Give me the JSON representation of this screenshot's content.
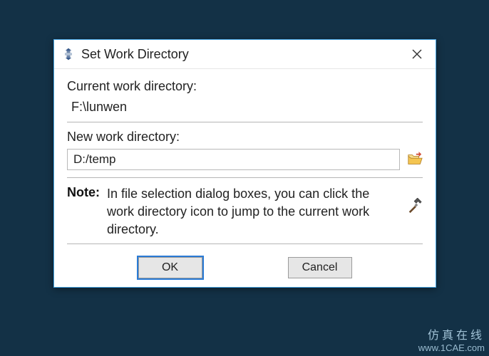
{
  "dialog": {
    "title": "Set Work Directory",
    "current_label": "Current work directory:",
    "current_value": "F:\\lunwen",
    "new_label": "New work directory:",
    "new_value": "D:/temp",
    "note_label": "Note:",
    "note_text": "In file selection dialog boxes, you can click the work directory icon to jump to the current work directory.",
    "ok_label": "OK",
    "cancel_label": "Cancel"
  },
  "watermark": {
    "line1": "仿真在线",
    "line2": "www.1CAE.com"
  },
  "bg_watermark": "CAE.COM"
}
